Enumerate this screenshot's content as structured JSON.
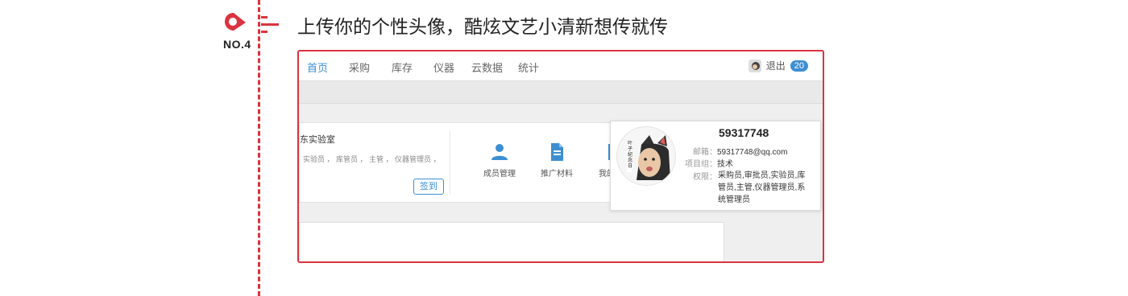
{
  "step": {
    "label": "NO.4"
  },
  "headline": "上传你的个性头像，酷炫文艺小清新想传就传",
  "colors": {
    "accent_red": "#d9343f",
    "link_blue": "#3d8fd1"
  },
  "nav": {
    "items": [
      "首页",
      "采购",
      "库存",
      "仪器",
      "云数据",
      "统计"
    ],
    "active": "首页",
    "logout": "退出",
    "badge_count": "20"
  },
  "lab_card": {
    "name": "东实验室",
    "roles": "实验员 ， 库管员 ， 主管 ， 仪器管理员 ，",
    "sign_button": "签到"
  },
  "quick_actions": [
    {
      "label": "成员管理",
      "icon": "person-icon"
    },
    {
      "label": "推广材料",
      "icon": "document-icon"
    },
    {
      "label": "我的",
      "icon": "partial-icon"
    }
  ],
  "profile_popup": {
    "user_id": "59317748",
    "email_label": "邮箱：",
    "email": "59317748@qq.com",
    "group_label": "项目组：",
    "group": "技术",
    "perm_label": "权限：",
    "permissions": "采购员,审批员,实验员,库管员,主管,仪器管理员,系统管理员",
    "avatar_caption": "叶子紀念日"
  }
}
